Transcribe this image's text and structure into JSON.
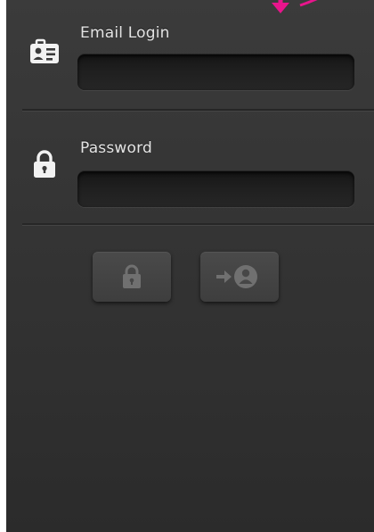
{
  "login_form": {
    "email": {
      "label": "Email Login",
      "value": "",
      "placeholder": "",
      "icon": "id-card-icon"
    },
    "password": {
      "label": "Password",
      "value": "",
      "placeholder": "",
      "icon": "padlock-icon"
    },
    "actions": [
      {
        "name": "lock-button",
        "icon": "padlock-icon"
      },
      {
        "name": "login-button",
        "icon": "login-user-icon"
      }
    ]
  },
  "colors": {
    "background": "#363636",
    "text": "#e4e4e4",
    "input_background": "#1c1c1c",
    "button_background": "#444444",
    "button_icon": "#6e6e6e",
    "annotation_arrow": "#e8158c"
  }
}
